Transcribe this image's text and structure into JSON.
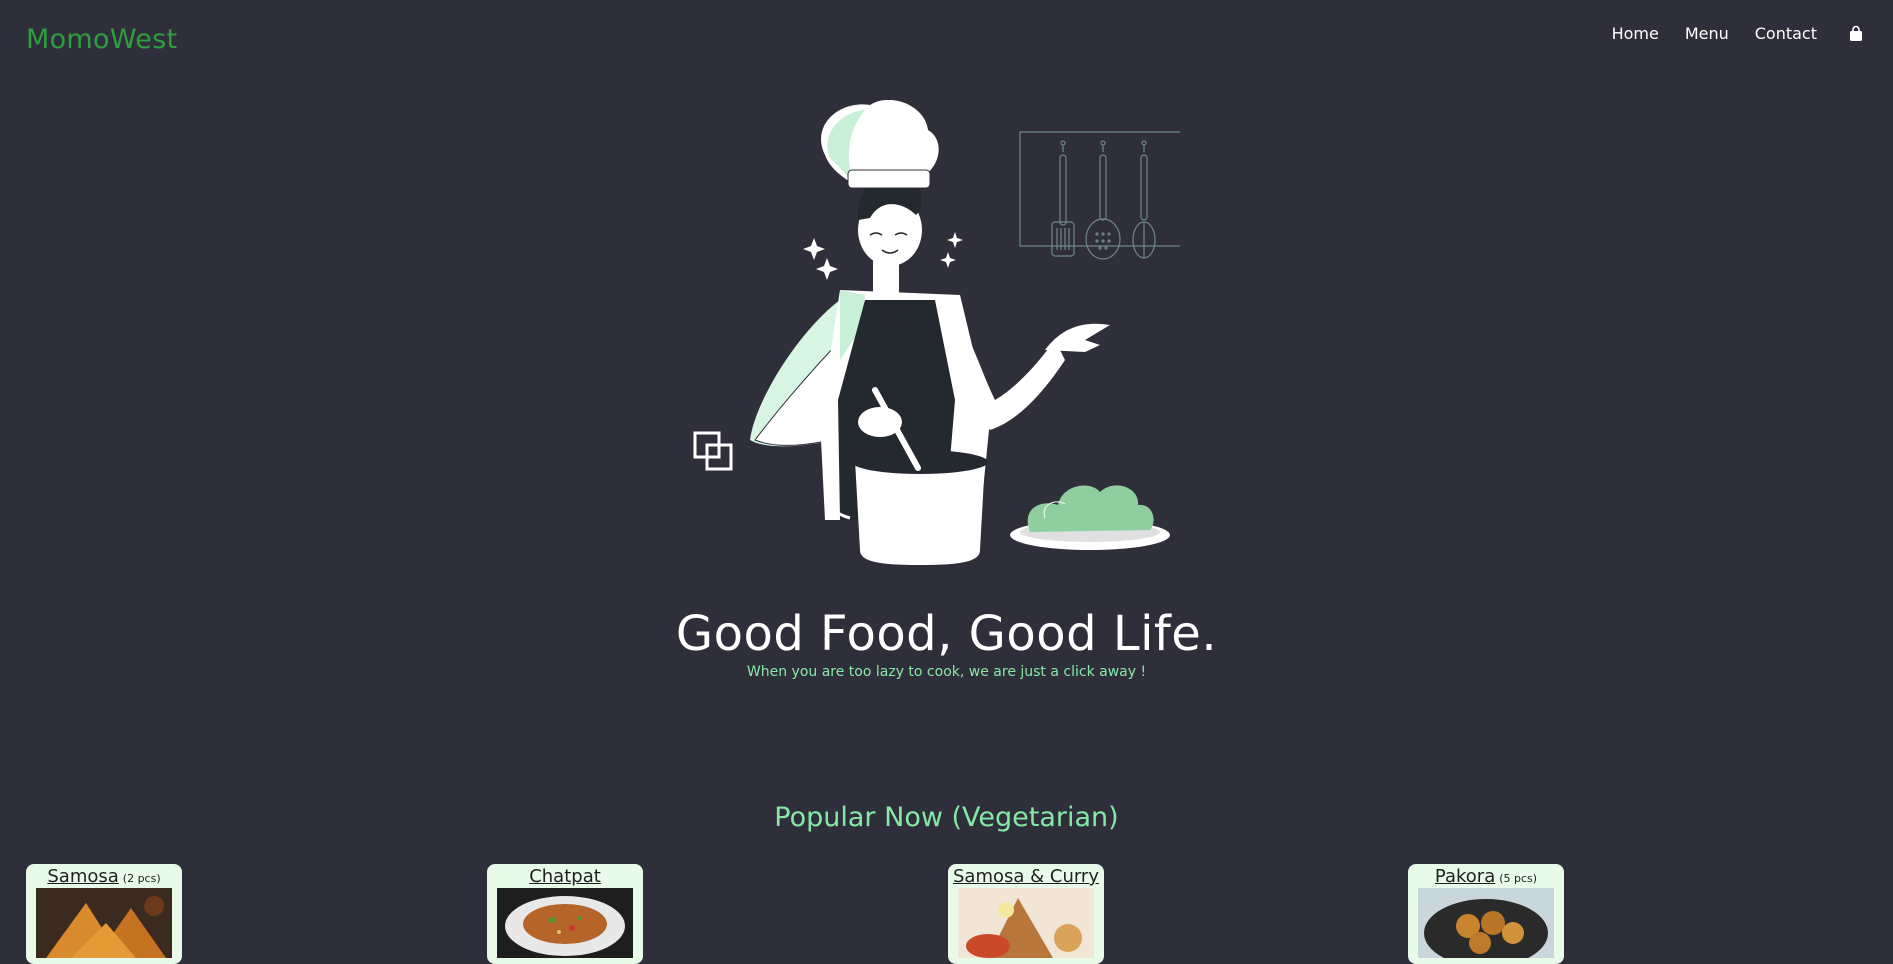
{
  "nav": {
    "brand": "MomoWest",
    "links": [
      "Home",
      "Menu",
      "Contact"
    ],
    "cart_icon": "cart-bag-icon"
  },
  "hero": {
    "illustration": "chef-cooking-illustration",
    "title": "Good Food, Good Life.",
    "subtitle": "When you are too lazy to cook, we are just a click away !"
  },
  "popular": {
    "title": "Popular Now (Vegetarian)",
    "items": [
      {
        "name": "Samosa",
        "qty": "(2 pcs)"
      },
      {
        "name": "Chatpat",
        "qty": ""
      },
      {
        "name": "Samosa & Curry",
        "qty": ""
      },
      {
        "name": "Pakora",
        "qty": "(5 pcs)"
      }
    ]
  },
  "colors": {
    "background": "#2f2f3b",
    "brand": "#2e9e3e",
    "accent": "#86e8a6",
    "card": "#e8fbe9"
  }
}
